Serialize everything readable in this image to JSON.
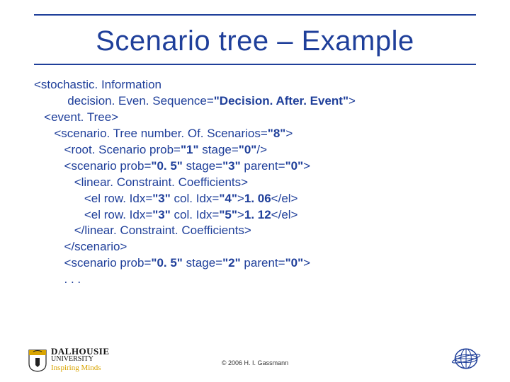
{
  "title": "Scenario tree – Example",
  "code": {
    "l1a": "<stochastic. Information",
    "l1b": "decision. Even. Sequence=",
    "l1c": "\"Decision. After. Event\"",
    "l1d": ">",
    "l2": "<event. Tree>",
    "l3a": "<scenario. Tree number. Of. Scenarios=",
    "l3b": "\"8\"",
    "l3c": ">",
    "l4a": "<root. Scenario prob=",
    "l4b": "\"1\"",
    "l4c": " stage=",
    "l4d": "\"0\"",
    "l4e": "/>",
    "l5a": "<scenario prob=",
    "l5b": "\"0. 5\"",
    "l5c": " stage=",
    "l5d": "\"3\"",
    "l5e": " parent=",
    "l5f": "\"0\"",
    "l5g": ">",
    "l6": "<linear. Constraint. Coefficients>",
    "l7a": "<el row. Idx=",
    "l7b": "\"3\"",
    "l7c": " col. Idx=",
    "l7d": "\"4\"",
    "l7e": ">",
    "l7f": "1. 06",
    "l7g": "</el>",
    "l8a": "<el row. Idx=",
    "l8b": "\"3\"",
    "l8c": " col. Idx=",
    "l8d": "\"5\"",
    "l8e": ">",
    "l8f": "1. 12",
    "l8g": "</el>",
    "l9": "</linear. Constraint. Coefficients>",
    "l10": "</scenario>",
    "l11a": "<scenario prob=",
    "l11b": "\"0. 5\"",
    "l11c": " stage=",
    "l11d": "\"2\"",
    "l11e": " parent=",
    "l11f": "\"0\"",
    "l11g": ">",
    "l12": ". . ."
  },
  "footer": {
    "university_name": "DALHOUSIE",
    "university_sub": "UNIVERSITY",
    "tagline": "Inspiring Minds",
    "copyright": "© 2006 H. I. Gassmann"
  }
}
